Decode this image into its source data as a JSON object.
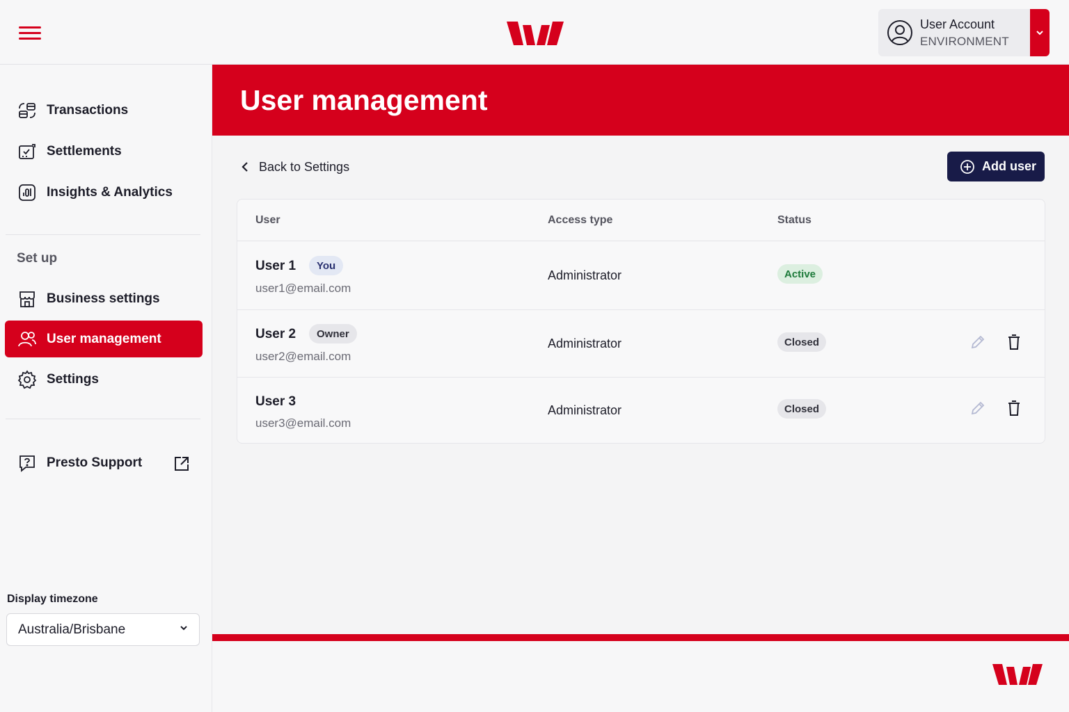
{
  "header": {
    "account_name": "User Account",
    "account_env": "ENVIRONMENT"
  },
  "sidebar": {
    "items": [
      {
        "label": "Transactions",
        "icon": "transactions-icon"
      },
      {
        "label": "Settlements",
        "icon": "settlements-icon"
      },
      {
        "label": "Insights & Analytics",
        "icon": "analytics-icon"
      }
    ],
    "setup_label": "Set up",
    "setup_items": [
      {
        "label": "Business settings",
        "icon": "store-icon"
      },
      {
        "label": "User management",
        "icon": "users-icon",
        "active": true
      },
      {
        "label": "Settings",
        "icon": "gear-icon"
      }
    ],
    "support_label": "Presto Support",
    "timezone_label": "Display timezone",
    "timezone_value": "Australia/Brisbane"
  },
  "page": {
    "title": "User management",
    "back_label": "Back to Settings",
    "add_user_label": "Add user"
  },
  "table": {
    "columns": [
      "User",
      "Access type",
      "Status"
    ],
    "rows": [
      {
        "name": "User 1",
        "tag": "You",
        "email": "user1@email.com",
        "access": "Administrator",
        "status": "Active"
      },
      {
        "name": "User 2",
        "tag": "Owner",
        "email": "user2@email.com",
        "access": "Administrator",
        "status": "Closed"
      },
      {
        "name": "User 3",
        "tag": "",
        "email": "user3@email.com",
        "access": "Administrator",
        "status": "Closed"
      }
    ]
  },
  "colors": {
    "brand_red": "#d5001c",
    "button_navy": "#181b48",
    "active_green": "#1d7a3a"
  }
}
